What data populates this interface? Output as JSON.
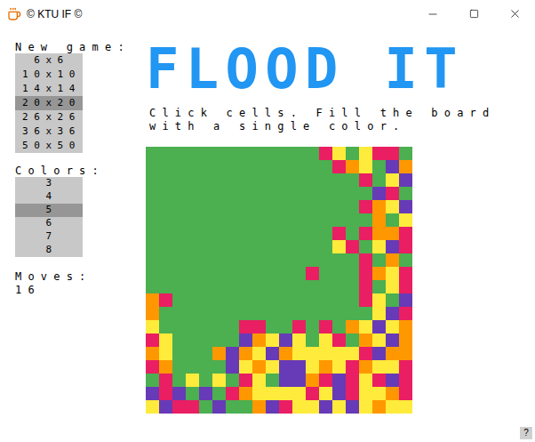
{
  "window": {
    "title": "© KTU IF ©"
  },
  "new_game": {
    "label": "New game:",
    "options": [
      {
        "label": "6x6",
        "selected": false
      },
      {
        "label": "10x10",
        "selected": false
      },
      {
        "label": "14x14",
        "selected": false
      },
      {
        "label": "20x20",
        "selected": true
      },
      {
        "label": "26x26",
        "selected": false
      },
      {
        "label": "36x36",
        "selected": false
      },
      {
        "label": "50x50",
        "selected": false
      }
    ]
  },
  "colors": {
    "label": "Colors:",
    "options": [
      {
        "label": "3",
        "selected": false
      },
      {
        "label": "4",
        "selected": false
      },
      {
        "label": "5",
        "selected": true
      },
      {
        "label": "6",
        "selected": false
      },
      {
        "label": "7",
        "selected": false
      },
      {
        "label": "8",
        "selected": false
      }
    ]
  },
  "moves": {
    "label": "Moves:",
    "value": "16"
  },
  "logo": "FLOOD IT",
  "instructions": [
    "Click cells. Fill the board",
    "with a single color."
  ],
  "help_button": "?",
  "board": {
    "palette": {
      "G": "#4caf50",
      "R": "#e91e63",
      "O": "#ff9800",
      "Y": "#ffeb3b",
      "P": "#673ab7"
    },
    "rows": [
      "GGGGGGGGGGGGGRYGYRRG",
      "GGGGGGGGGGGGGGROYGPO",
      "GGGGGGGGGGGGGGGGRGYP",
      "GGGGGGGGGGGGGGGGGPRG",
      "GGGGGGGGGGGGGGGGROYP",
      "GGGGGGGGGGGGGGGGGOGY",
      "GGGGGGGGGGGGGGRGROOR",
      "GGGGGGGGGGGGGGYRGYPR",
      "GGGGGGGGGGGGGGGGRGOG",
      "GGGGGGGGGGGGRGGGROYR",
      "GGGGGGGGGGGGGGGGRGYR",
      "ORGGGGGGGGGGGGGGRYGP",
      "OGGGGGGGGGGGGGGGGYPR",
      "YGGGGGGRRGGRGRGOYPYO",
      "RYGGGGGPOYPYGYRGOYPO",
      "OYGGGOPOYPOYYYYYRPOO",
      "ROGGGGPYOYPPYOYROYYR",
      "GRGYGYGRYGPPORPRYRPR",
      "PRPGPGROYYYYRYPRYYOR",
      "YPRRGPGGOPRYYPYPYOYY"
    ]
  }
}
